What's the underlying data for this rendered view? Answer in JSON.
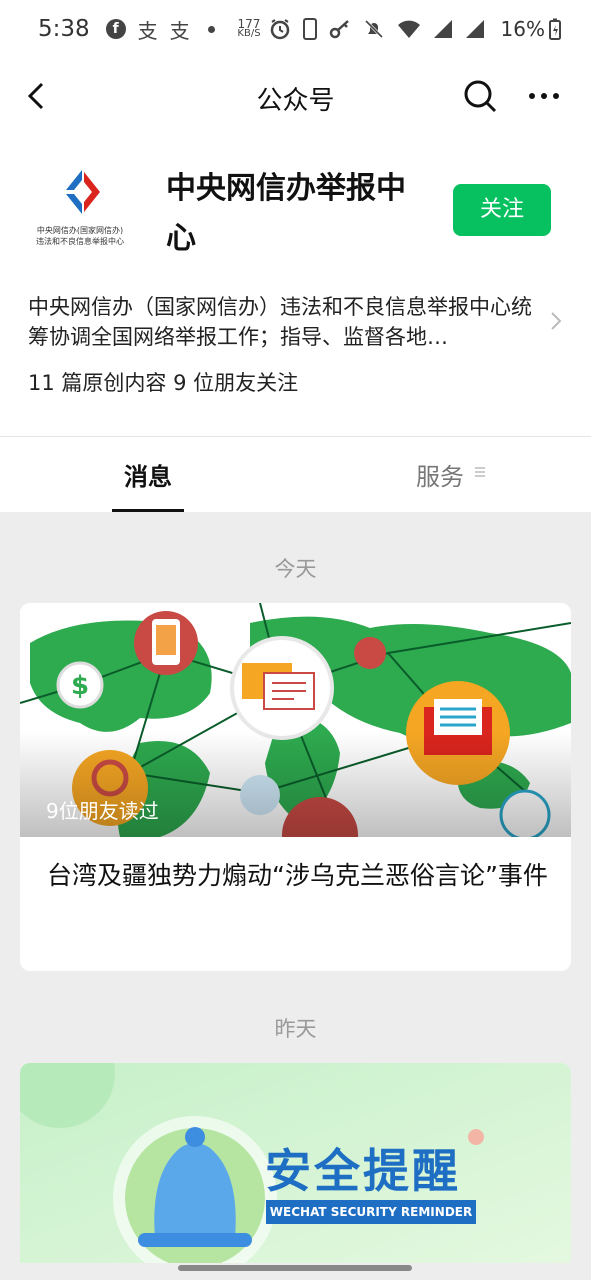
{
  "status_bar": {
    "time": "5:38",
    "net_speed_value": "177",
    "net_speed_unit": "KB/S",
    "battery": "16%",
    "notif_char": "支",
    "icons": [
      "facebook-icon",
      "alipay-icon",
      "alipay-icon",
      "dot-icon",
      "alarm-icon",
      "phone-icon",
      "key-icon",
      "mute-icon",
      "wifi-icon",
      "signal-icon",
      "signal-icon",
      "battery-icon"
    ]
  },
  "nav": {
    "title": "公众号"
  },
  "account": {
    "logo_caption_1": "中央网信办(国家网信办)",
    "logo_caption_2": "违法和不良信息举报中心",
    "name": "中央网信办举报中心",
    "follow_label": "关注",
    "description": "中央网信办（国家网信办）违法和不良信息举报中心统筹协调全国网络举报工作；指导、监督各地…",
    "stats": "11 篇原创内容  9 位朋友关注"
  },
  "tabs": [
    {
      "label": "消息",
      "active": true
    },
    {
      "label": "服务",
      "active": false
    }
  ],
  "feed": [
    {
      "date": "今天",
      "readers": "9位朋友读过",
      "headline": "台湾及疆独势力煽动“涉乌克兰恶俗言论”事件"
    },
    {
      "date": "昨天",
      "banner_title": "安全提醒",
      "banner_sub": "WECHAT SECURITY REMINDER"
    }
  ],
  "colors": {
    "accent_green": "#07c160",
    "reminder_blue": "#1e6fc4",
    "map_green": "#2eaa4f"
  }
}
